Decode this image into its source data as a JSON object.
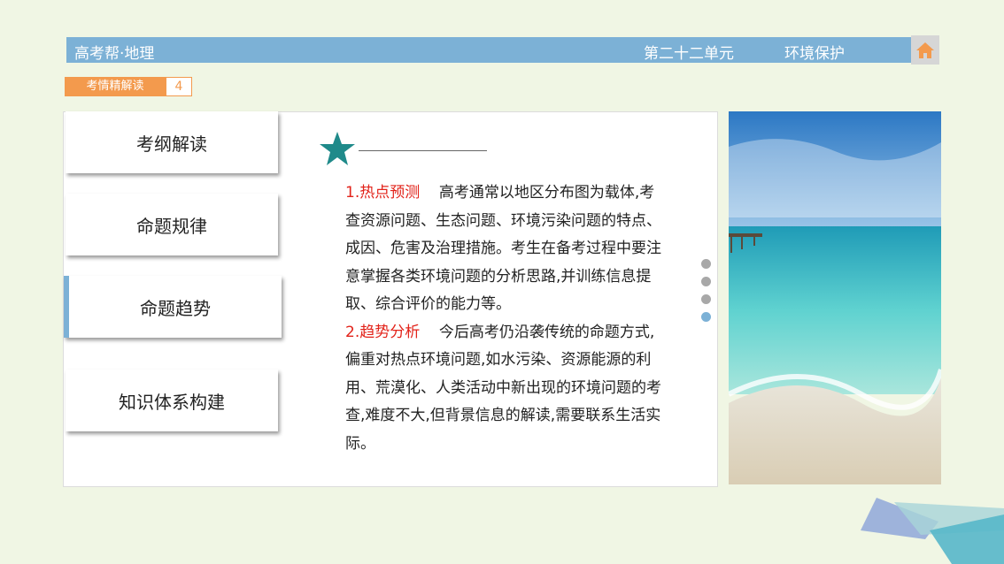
{
  "header": {
    "brand": "高考帮·地理",
    "unit": "第二十二单元",
    "topic": "环境保护"
  },
  "section": {
    "label": "考情精解读",
    "number": "4"
  },
  "sidebar": {
    "items": [
      {
        "label": "考纲解读"
      },
      {
        "label": "命题规律"
      },
      {
        "label": "命题趋势"
      },
      {
        "label": "知识体系构建"
      }
    ],
    "active_index": 2
  },
  "content": {
    "p1_heading": "1.热点预测",
    "p1_body": "高考通常以地区分布图为载体,考查资源问题、生态问题、环境污染问题的特点、成因、危害及治理措施。考生在备考过程中要注意掌握各类环境问题的分析思路,并训练信息提取、综合评价的能力等。",
    "p2_heading": "2.趋势分析",
    "p2_body": "今后高考仍沿袭传统的命题方式,偏重对热点环境问题,如水污染、资源能源的利用、荒漠化、人类活动中新出现的环境问题的考查,难度不大,但背景信息的解读,需要联系生活实际。"
  },
  "pager": {
    "count": 4,
    "active_index": 3
  },
  "colors": {
    "header": "#7cb1d6",
    "tag": "#f39a4d",
    "star": "#1f8a8a",
    "highlight": "#e2231a"
  },
  "icons": {
    "home": "home-icon",
    "star": "star-icon"
  }
}
